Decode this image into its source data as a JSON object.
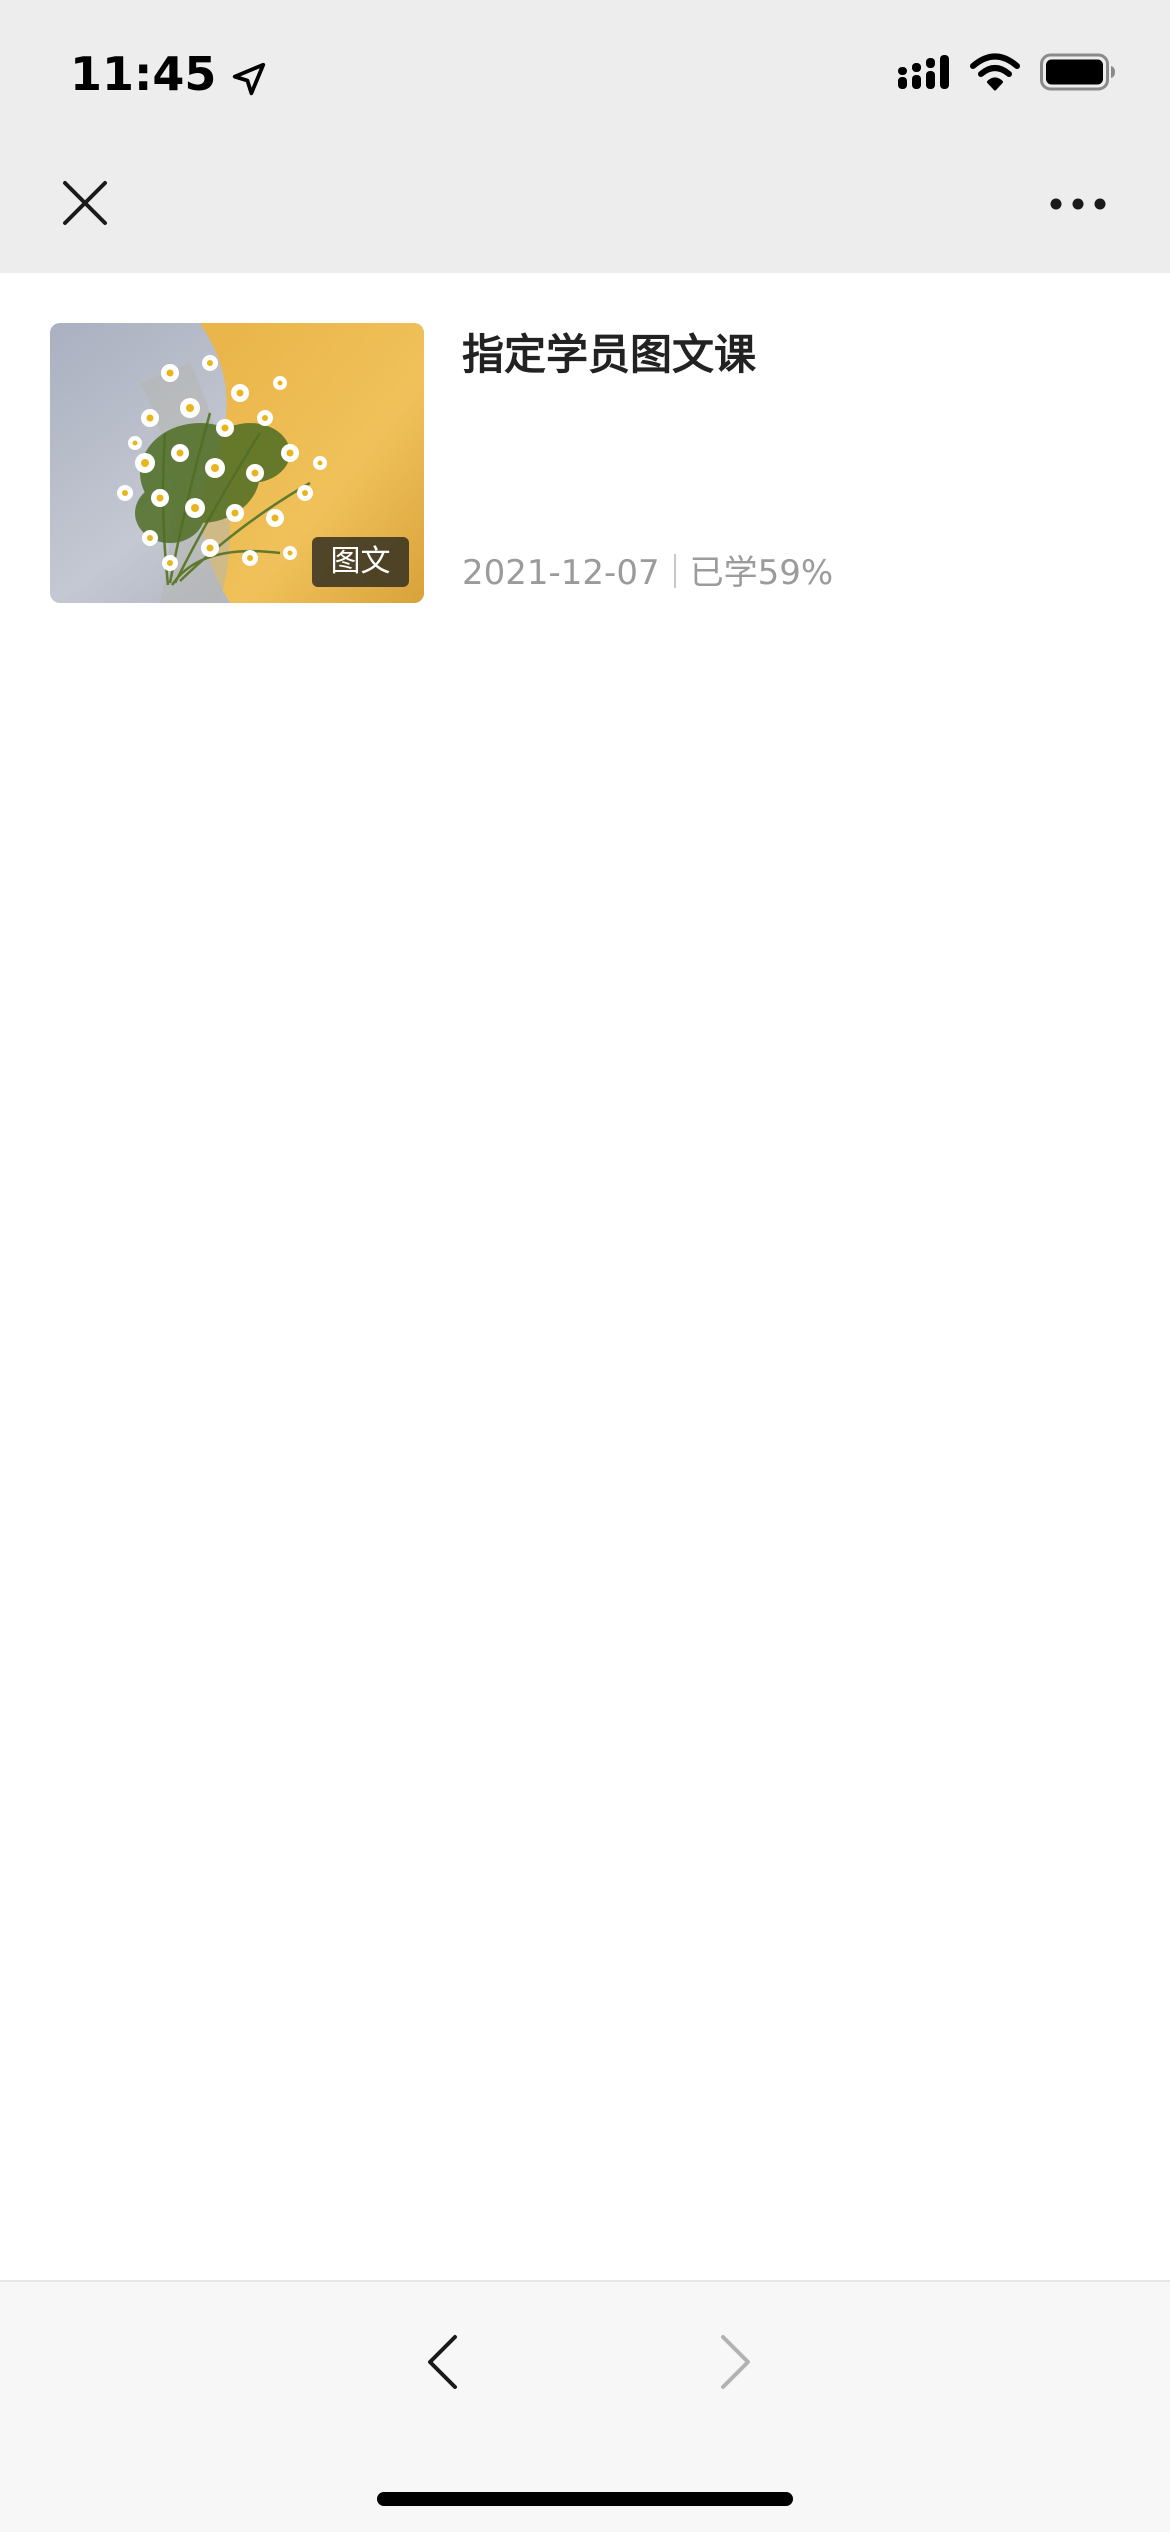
{
  "status_bar": {
    "time": "11:45",
    "icons": [
      "location-arrow-icon",
      "signal-icon",
      "wifi-icon",
      "battery-icon"
    ]
  },
  "header": {
    "close_icon": "close-icon",
    "more_icon": "more-dots-icon"
  },
  "course": {
    "title": "指定学员图文课",
    "tag": "图文",
    "date": "2021-12-07",
    "progress_text": "已学59%"
  },
  "toolbar": {
    "back_icon": "chevron-left-icon",
    "forward_icon": "chevron-right-icon"
  },
  "colors": {
    "header_bg": "#ededed",
    "toolbar_bg": "#f7f7f7",
    "title": "#222222",
    "meta": "#9b9b9b",
    "disabled_icon": "#b2b2b2"
  }
}
